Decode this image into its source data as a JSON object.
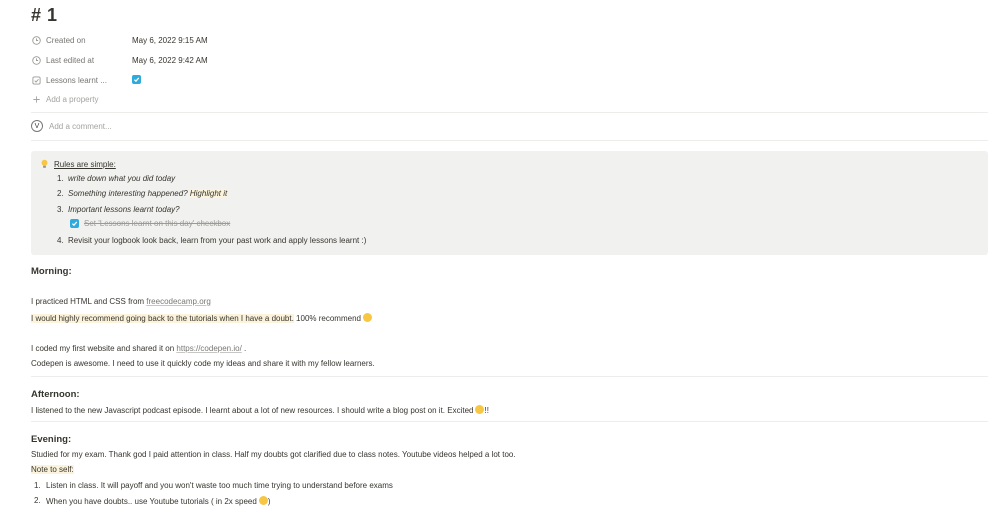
{
  "page": {
    "title": "# 1"
  },
  "properties": [
    {
      "icon": "clock-icon",
      "label": "Created on",
      "value": "May 6, 2022 9:15 AM"
    },
    {
      "icon": "clock-icon",
      "label": "Last edited at",
      "value": "May 6, 2022 9:42 AM"
    },
    {
      "icon": "checkbox-property-icon",
      "label": "Lessons learnt ...",
      "checked": true
    }
  ],
  "add_property": {
    "icon": "plus-icon",
    "label": "Add a property"
  },
  "comment": {
    "avatar_letter": "V",
    "placeholder": "Add a comment..."
  },
  "callout": {
    "icon": "lightbulb-icon",
    "heading": "Rules are simple:",
    "items": [
      {
        "num": "1.",
        "text": "write down what you did today"
      },
      {
        "num": "2.",
        "text": "Something interesting happened? ",
        "highlight": "Highlight it"
      },
      {
        "num": "3.",
        "text": "Important lessons learnt today?"
      },
      {
        "num": "4.",
        "text": "Revisit your logbook look back, learn from your past work and apply lessons learnt :)"
      }
    ],
    "sub_todo": {
      "checked": true,
      "text": "Set 'Lessons learnt on this day' checkbox"
    }
  },
  "morning": {
    "heading": "Morning:",
    "p1_prefix": "I practiced HTML and CSS from ",
    "p1_link": "freecodecamp.org",
    "p2_highlight": "I would highly recommend going back to the tutorials when I have a doubt.",
    "p2_rest": " 100% recommend",
    "p3_prefix": "I coded my first website and shared it on ",
    "p3_link": "https://codepen.io/",
    "p3_suffix": " .",
    "p4": "Codepen is awesome. I need to use it quickly code my ideas and share it with my fellow learners."
  },
  "afternoon": {
    "heading": "Afternoon:",
    "p1": "I listened to the new Javascript podcast episode. I learnt about a lot of new resources. I should write a blog post on it. Excited",
    "p1_suffix": "!!"
  },
  "evening": {
    "heading": "Evening:",
    "p1": "Studied for my exam. Thank god I paid attention in class. Half my doubts got clarified due to class notes. Youtube videos helped a lot too.",
    "note": "Note to self:",
    "items": [
      {
        "num": "1.",
        "text": "Listen in class. It will payoff and you won't waste too much time trying to understand before exams"
      },
      {
        "num": "2.",
        "text": "When you have doubts.. use Youtube tutorials ( in 2x speed",
        "suffix": ")"
      }
    ]
  }
}
